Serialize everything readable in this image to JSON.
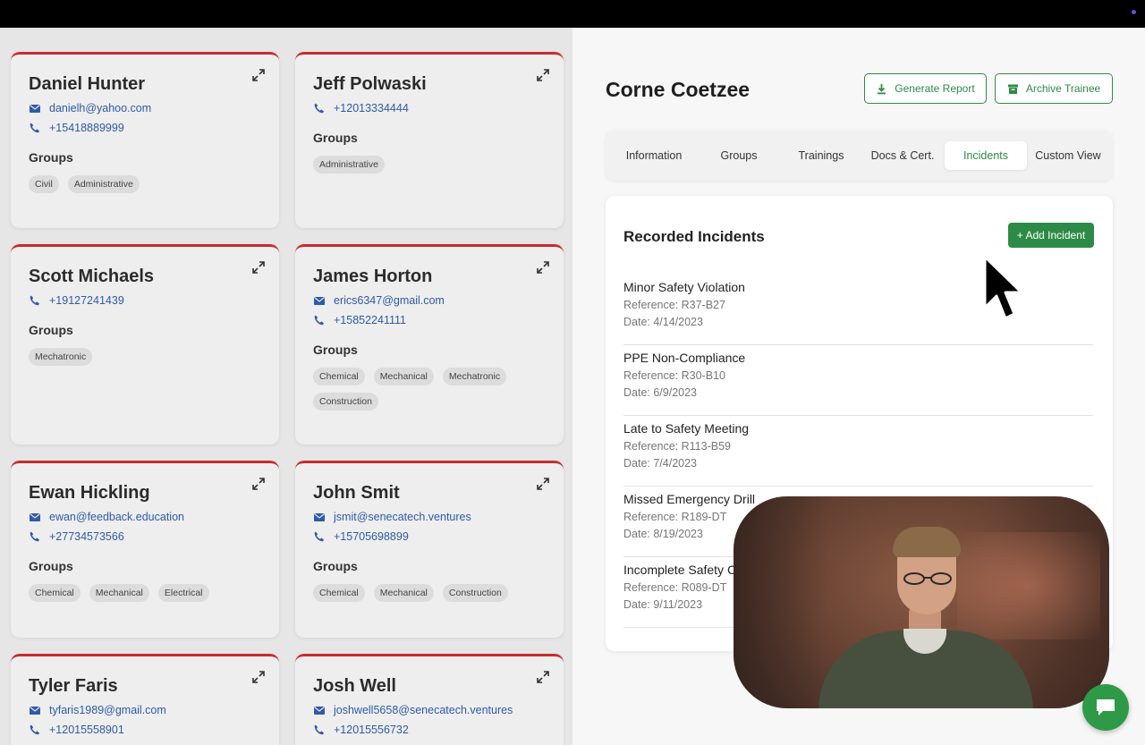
{
  "trainees": [
    {
      "name": "Daniel Hunter",
      "email": "danielh@yahoo.com",
      "phone": "+15418889999",
      "groups_label": "Groups",
      "groups": [
        "Civil",
        "Administrative"
      ]
    },
    {
      "name": "Jeff Polwaski",
      "email": "",
      "phone": "+12013334444",
      "groups_label": "Groups",
      "groups": [
        "Administrative"
      ]
    },
    {
      "name": "Scott Michaels",
      "email": "",
      "phone": "+19127241439",
      "groups_label": "Groups",
      "groups": [
        "Mechatronic"
      ]
    },
    {
      "name": "James Horton",
      "email": "erics6347@gmail.com",
      "phone": "+15852241111",
      "groups_label": "Groups",
      "groups": [
        "Chemical",
        "Mechanical",
        "Mechatronic",
        "Construction"
      ]
    },
    {
      "name": "Ewan Hickling",
      "email": "ewan@feedback.education",
      "phone": "+27734573566",
      "groups_label": "Groups",
      "groups": [
        "Chemical",
        "Mechanical",
        "Electrical"
      ]
    },
    {
      "name": "John Smit",
      "email": "jsmit@senecatech.ventures",
      "phone": "+15705698899",
      "groups_label": "Groups",
      "groups": [
        "Chemical",
        "Mechanical",
        "Construction"
      ]
    },
    {
      "name": "Tyler Faris",
      "email": "tyfaris1989@gmail.com",
      "phone": "+12015558901",
      "groups_label": "",
      "groups": []
    },
    {
      "name": "Josh Well",
      "email": "joshwell5658@senecatech.ventures",
      "phone": "+12015556732",
      "groups_label": "",
      "groups": []
    }
  ],
  "detail": {
    "name": "Corne Coetzee",
    "generate_report": "Generate Report",
    "archive_trainee": "Archive Trainee",
    "tabs": [
      "Information",
      "Groups",
      "Trainings",
      "Docs & Cert.",
      "Incidents",
      "Custom View"
    ],
    "active_tab": "Incidents",
    "incidents_title": "Recorded Incidents",
    "add_incident": "+ Add Incident",
    "incidents": [
      {
        "title": "Minor Safety Violation",
        "reference": "Reference: R37-B27",
        "date": "Date: 4/14/2023"
      },
      {
        "title": "PPE Non-Compliance",
        "reference": "Reference: R30-B10",
        "date": "Date: 6/9/2023"
      },
      {
        "title": "Late to Safety Meeting",
        "reference": "Reference: R113-B59",
        "date": "Date: 7/4/2023"
      },
      {
        "title": "Missed Emergency Drill",
        "reference": "Reference: R189-DT",
        "date": "Date: 8/19/2023"
      },
      {
        "title": "Incomplete Safety C",
        "reference": "Reference: R089-DT",
        "date": "Date: 9/11/2023"
      }
    ]
  },
  "colors": {
    "accent": "#2e8b47",
    "card_top_border": "#c62d2d",
    "link": "#2f5aa8"
  },
  "icons": {
    "expand": "expand-icon",
    "email": "email-icon",
    "phone": "phone-icon",
    "download": "download-icon",
    "archive": "archive-icon",
    "chat": "chat-icon"
  }
}
